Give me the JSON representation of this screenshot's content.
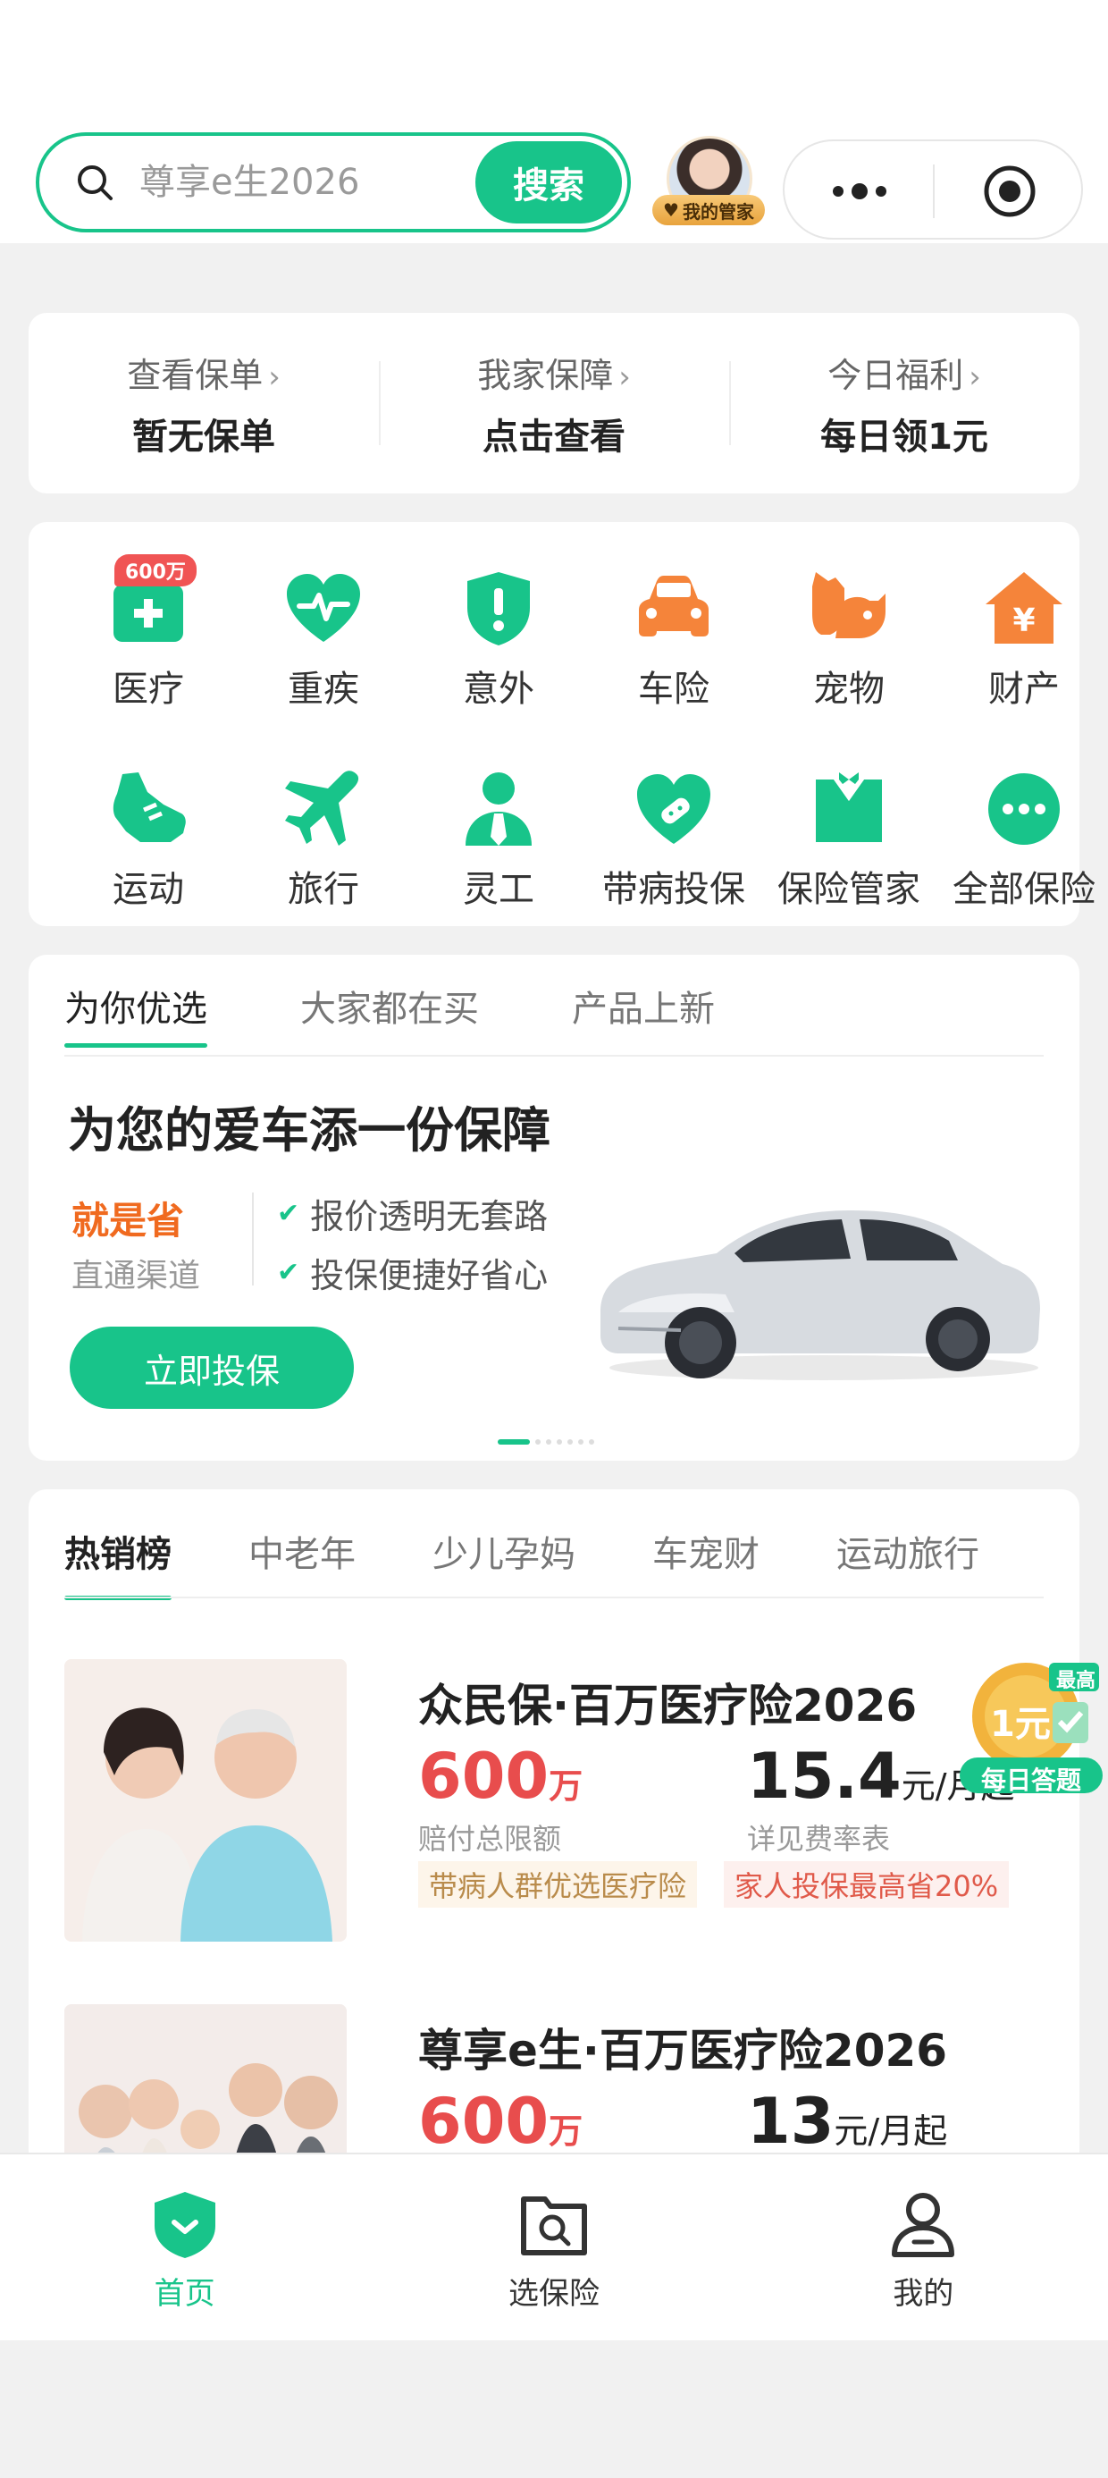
{
  "search": {
    "placeholder": "尊享e生2026",
    "button": "搜索"
  },
  "steward": {
    "badge": "我的管家"
  },
  "policy_bar": [
    {
      "label": "查看保单",
      "value": "暂无保单"
    },
    {
      "label": "我家保障",
      "value": "点击查看"
    },
    {
      "label": "今日福利",
      "value": "每日领1元"
    }
  ],
  "categories": [
    {
      "label": "医疗",
      "icon": "medical-kit-icon",
      "color": "#18c48a",
      "badge": "600万"
    },
    {
      "label": "重疾",
      "icon": "heart-pulse-icon",
      "color": "#18c48a"
    },
    {
      "label": "意外",
      "icon": "shield-alert-icon",
      "color": "#18c48a"
    },
    {
      "label": "车险",
      "icon": "car-icon",
      "color": "#f5843a"
    },
    {
      "label": "宠物",
      "icon": "pet-icon",
      "color": "#f5843a"
    },
    {
      "label": "财产",
      "icon": "house-yen-icon",
      "color": "#f5843a"
    },
    {
      "label": "运动",
      "icon": "sneaker-icon",
      "color": "#18c48a"
    },
    {
      "label": "旅行",
      "icon": "airplane-icon",
      "color": "#18c48a"
    },
    {
      "label": "灵工",
      "icon": "worker-icon",
      "color": "#18c48a"
    },
    {
      "label": "带病投保",
      "icon": "heart-bandage-icon",
      "color": "#18c48a"
    },
    {
      "label": "保险管家",
      "icon": "butler-icon",
      "color": "#18c48a"
    },
    {
      "label": "全部保险",
      "icon": "more-dots-icon",
      "color": "#18c48a"
    }
  ],
  "feature": {
    "tabs": [
      "为你优选",
      "大家都在买",
      "产品上新"
    ],
    "title": "为您的爱车添一份保障",
    "highlight": "就是省",
    "subhighlight": "直通渠道",
    "checks": [
      "报价透明无套路",
      "投保便捷好省心"
    ],
    "cta": "立即投保"
  },
  "ranking": {
    "tabs": [
      "热销榜",
      "中老年",
      "少儿孕妈",
      "车宠财",
      "运动旅行"
    ],
    "products": [
      {
        "title": "众民保·百万医疗险2026",
        "amount": "600",
        "amount_unit": "万",
        "amount_label": "赔付总限额",
        "price": "15.4",
        "price_unit": "元/月起",
        "price_label": "详见费率表",
        "tags": [
          "带病人群优选医疗险",
          "家人投保最高省20%"
        ]
      },
      {
        "title": "尊享e生·百万医疗险2026",
        "amount": "600",
        "amount_unit": "万",
        "price": "13",
        "price_unit": "元/月起"
      }
    ]
  },
  "quiz": {
    "top": "最高",
    "coin": "1元",
    "label": "每日答题"
  },
  "tabbar": [
    {
      "label": "首页",
      "active": true
    },
    {
      "label": "选保险",
      "active": false
    },
    {
      "label": "我的",
      "active": false
    }
  ],
  "colors": {
    "brand": "#18c48a",
    "orange": "#f5843a",
    "red": "#e84d4d"
  }
}
